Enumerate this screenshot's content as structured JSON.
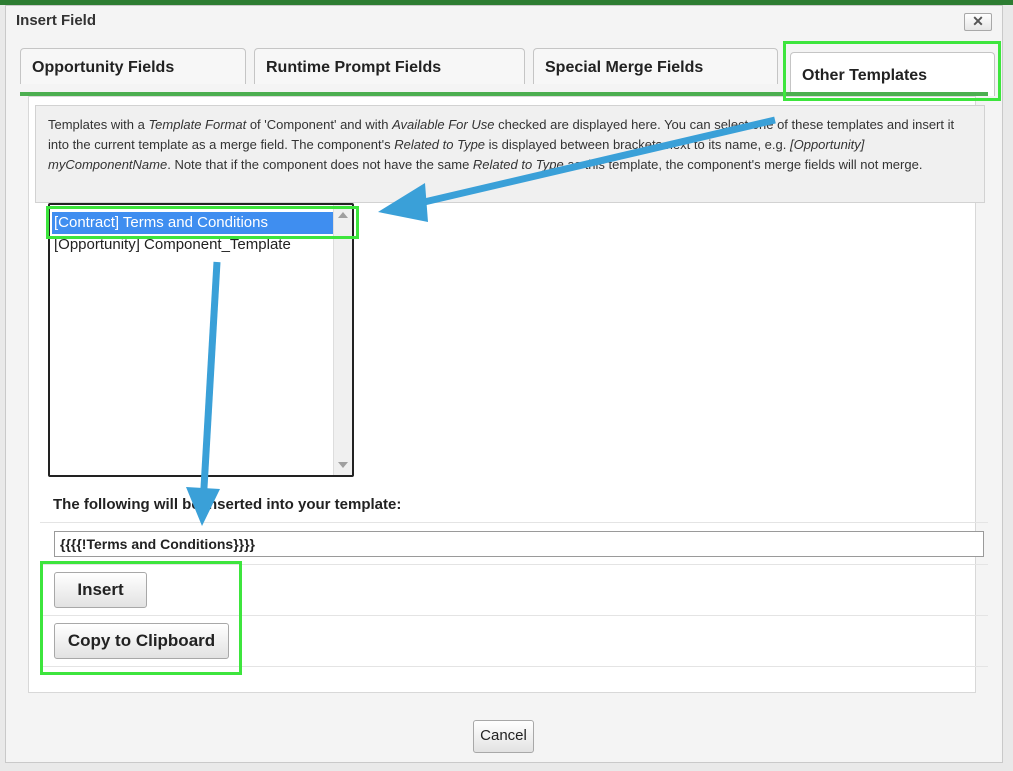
{
  "dialog": {
    "title": "Insert Field",
    "close_symbol": "✕",
    "close_icon": "close-icon"
  },
  "tabs": [
    {
      "label": "Opportunity Fields",
      "active": false
    },
    {
      "label": "Runtime Prompt Fields",
      "active": false
    },
    {
      "label": "Special Merge Fields",
      "active": false
    },
    {
      "label": "Other Templates",
      "active": true
    }
  ],
  "info": {
    "t1": "Templates with a ",
    "t2": "Template Format",
    "t3": " of 'Component' and with ",
    "t4": "Available For Use",
    "t5": " checked are displayed here. You can select one of these templates and insert it into the current template as a merge field. The component's ",
    "t6": "Related to Type",
    "t7": " is displayed between brackets next to its name, e.g. ",
    "t8": "[Opportunity] myComponentName",
    "t9": ". Note that if the component does not have the same ",
    "t10": "Related to Type",
    "t11": " as this template, the component's merge fields will not merge."
  },
  "templates": {
    "items": [
      {
        "label": "[Contract] Terms and Conditions",
        "selected": true
      },
      {
        "label": "[Opportunity] Component_Template",
        "selected": false
      }
    ]
  },
  "insert_label": "The following will be inserted into your template:",
  "merge_value": "{{{{!Terms and Conditions}}}}",
  "buttons": {
    "insert": "Insert",
    "copy": "Copy to Clipboard",
    "cancel": "Cancel"
  },
  "colors": {
    "highlight": "#3de53d",
    "arrow": "#3aa0d8",
    "selected_item": "#3f8ef0",
    "tab_underline": "#4caf50"
  }
}
